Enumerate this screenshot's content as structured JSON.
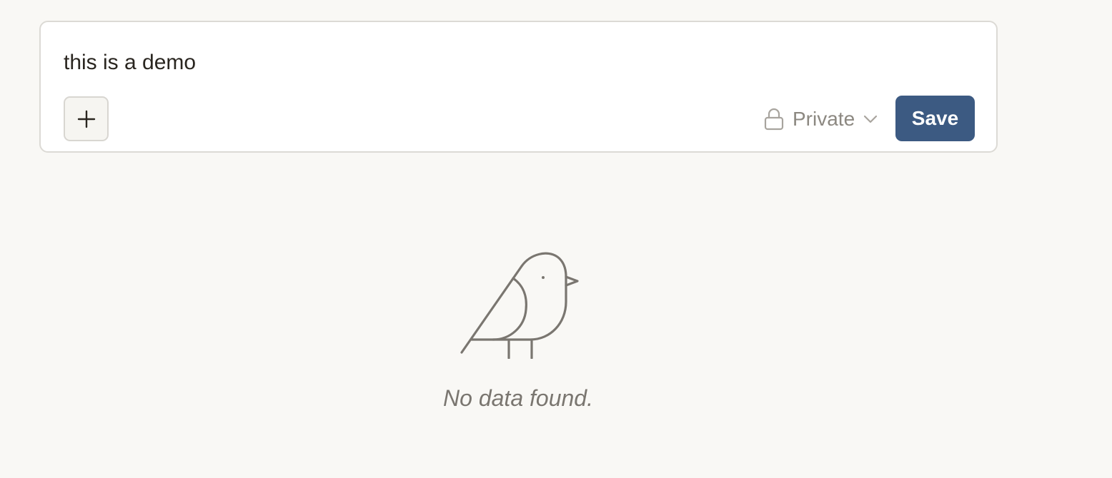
{
  "composer": {
    "text": "this is a demo",
    "add_icon": "plus-icon",
    "visibility": {
      "icon": "lock-icon",
      "label": "Private",
      "chevron_icon": "chevron-down-icon"
    },
    "save_label": "Save"
  },
  "empty_state": {
    "icon": "bird-icon",
    "message": "No data found."
  },
  "colors": {
    "background": "#f9f8f5",
    "card": "#ffffff",
    "accent": "#3c5a82",
    "muted_text": "#8c8881"
  }
}
